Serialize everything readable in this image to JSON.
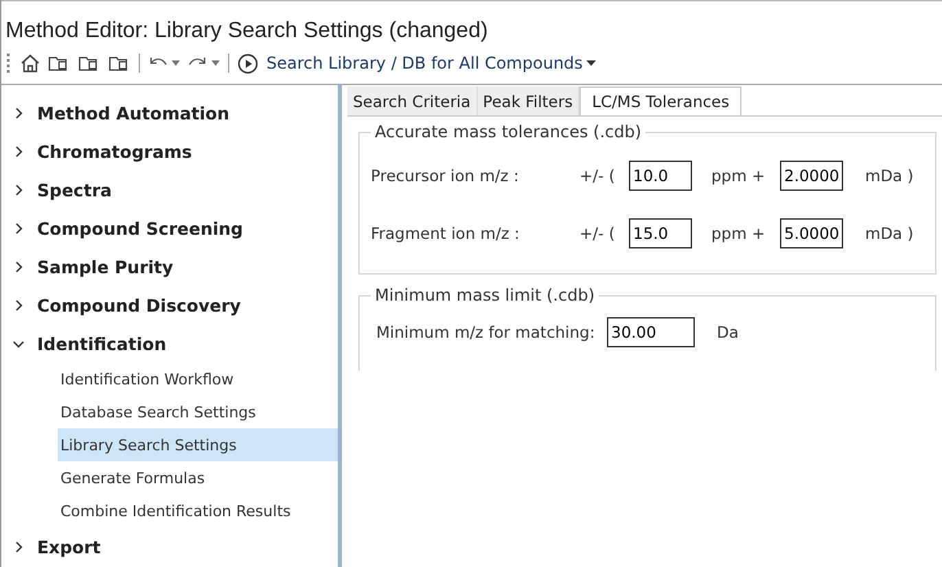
{
  "window": {
    "title": "Method Editor: Library Search Settings (changed)"
  },
  "toolbar": {
    "run_label": "Search Library / DB for All Compounds"
  },
  "sidebar": {
    "items": [
      {
        "label": "Method Automation",
        "expanded": false,
        "selected": false
      },
      {
        "label": "Chromatograms",
        "expanded": false,
        "selected": false
      },
      {
        "label": "Spectra",
        "expanded": false,
        "selected": false
      },
      {
        "label": "Compound Screening",
        "expanded": false,
        "selected": false
      },
      {
        "label": "Sample Purity",
        "expanded": false,
        "selected": false
      },
      {
        "label": "Compound Discovery",
        "expanded": false,
        "selected": false
      },
      {
        "label": "Identification",
        "expanded": true,
        "selected": false,
        "children": [
          {
            "label": "Identification Workflow",
            "selected": false
          },
          {
            "label": "Database Search Settings",
            "selected": false
          },
          {
            "label": "Library Search Settings",
            "selected": true
          },
          {
            "label": "Generate Formulas",
            "selected": false
          },
          {
            "label": "Combine Identification Results",
            "selected": false
          }
        ]
      },
      {
        "label": "Export",
        "expanded": false,
        "selected": false
      }
    ]
  },
  "tabs": [
    {
      "label": "Search Criteria",
      "selected": false
    },
    {
      "label": "Peak Filters",
      "selected": false
    },
    {
      "label": "LC/MS Tolerances",
      "selected": true
    }
  ],
  "groups": [
    {
      "title": "Accurate mass tolerances (.cdb)",
      "rows": [
        {
          "kind": "tolerance",
          "label": "Precursor ion m/z :",
          "prefix": "+/-  (",
          "value": "10.0",
          "mid": "ppm  +",
          "value2": "2.0000",
          "suffix": "mDa )"
        },
        {
          "kind": "tolerance",
          "label": "Fragment ion m/z :",
          "prefix": "+/-  (",
          "value": "15.0",
          "mid": "ppm  +",
          "value2": "5.0000",
          "suffix": "mDa )"
        }
      ]
    },
    {
      "title": "Minimum mass limit (.cdb)",
      "rows": [
        {
          "kind": "single",
          "label": "Minimum m/z for matching:",
          "value": "30.00",
          "suffix": "Da"
        }
      ]
    }
  ]
}
